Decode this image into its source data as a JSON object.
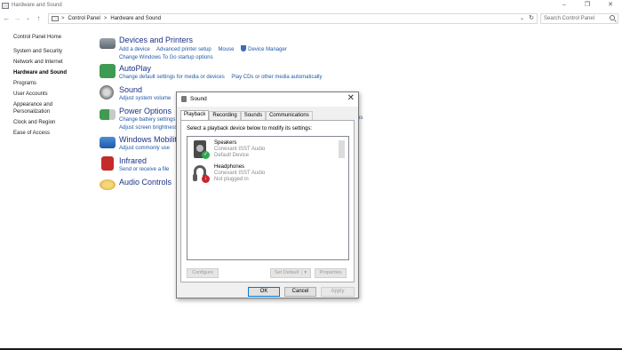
{
  "window": {
    "title": "Hardware and Sound",
    "controls": [
      "–",
      "❐",
      "✕"
    ]
  },
  "nav": {
    "back": "←",
    "forward": "→",
    "history": "⌄",
    "up": "↑",
    "breadcrumb": [
      "Control Panel",
      "Hardware and Sound"
    ],
    "separator": ">",
    "dropdown": "⌄",
    "refresh": "↻",
    "search_placeholder": "Search Control Panel"
  },
  "leftnav": {
    "items": [
      {
        "label": "Control Panel Home"
      },
      {
        "label": "System and Security"
      },
      {
        "label": "Network and Internet"
      },
      {
        "label": "Hardware and Sound",
        "active": true
      },
      {
        "label": "Programs"
      },
      {
        "label": "User Accounts"
      },
      {
        "label": "Appearance and Personalization"
      },
      {
        "label": "Clock and Region"
      },
      {
        "label": "Ease of Access"
      }
    ]
  },
  "categories": {
    "devices": {
      "title": "Devices and Printers",
      "links": [
        "Add a device",
        "Advanced printer setup",
        "Mouse",
        "Device Manager"
      ],
      "links2": [
        "Change Windows To Go startup options"
      ]
    },
    "autoplay": {
      "title": "AutoPlay",
      "links": [
        "Change default settings for media or devices",
        "Play CDs or other media automatically"
      ]
    },
    "sound": {
      "title": "Sound",
      "links": [
        "Adjust system volume"
      ]
    },
    "power": {
      "title": "Power Options",
      "links": [
        "Change battery settings"
      ],
      "links2": [
        "Adjust screen brightness"
      ],
      "partial": "ps"
    },
    "mobility": {
      "title": "Windows Mobility",
      "links": [
        "Adjust commonly use"
      ]
    },
    "infrared": {
      "title": "Infrared",
      "links": [
        "Send or receive a file"
      ]
    },
    "audio": {
      "title": "Audio Controls"
    }
  },
  "dialog": {
    "title": "Sound",
    "close": "✕",
    "tabs": [
      "Playback",
      "Recording",
      "Sounds",
      "Communications"
    ],
    "instruction": "Select a playback device below to modify its settings:",
    "devices": [
      {
        "name": "Speakers",
        "driver": "Conexant ISST Audio",
        "status": "Default Device",
        "badge": "✓"
      },
      {
        "name": "Headphones",
        "driver": "Conexant ISST Audio",
        "status": "Not plugged in",
        "badge": "↓"
      }
    ],
    "buttons": {
      "configure": "Configure",
      "set_default": "Set Default",
      "set_default_arrow": "▾",
      "properties": "Properties",
      "ok": "OK",
      "cancel": "Cancel",
      "apply": "Apply"
    }
  },
  "colors": {
    "link": "#1e5aa8",
    "heading": "#1e3287",
    "check": "#2da84a",
    "unplugged": "#c8262a"
  }
}
